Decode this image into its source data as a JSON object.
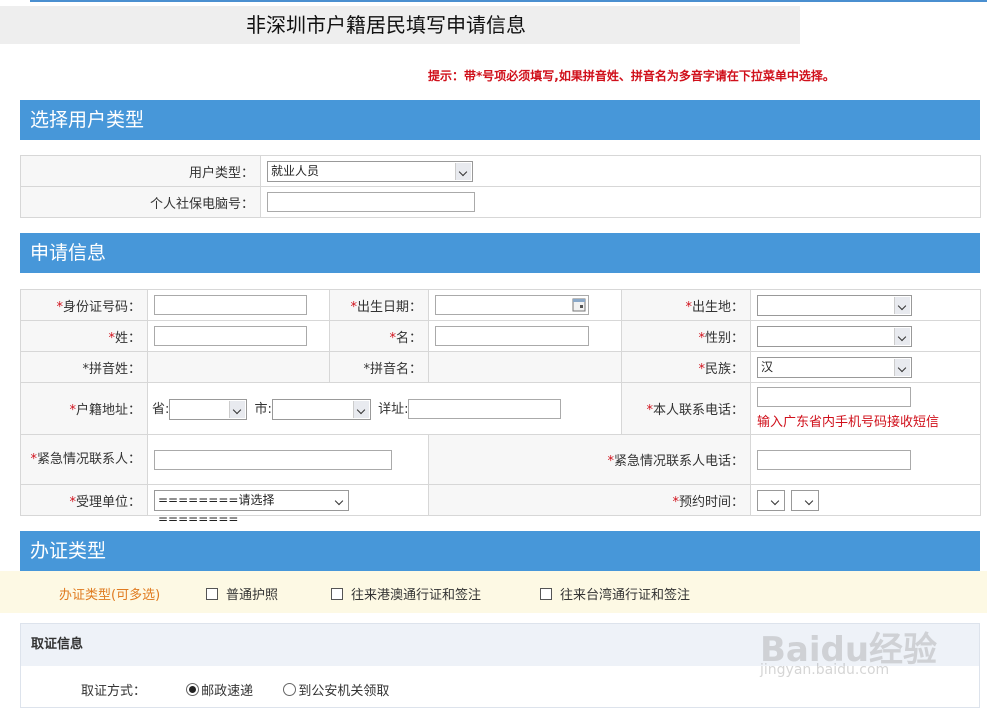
{
  "page_title": "非深圳市户籍居民填写申请信息",
  "tip": "提示：带*号项必须填写,如果拼音姓、拼音名为多音字请在下拉菜单中选择。",
  "section_user_type": {
    "title": "选择用户类型",
    "user_type_label": "用户类型：",
    "user_type_value": "就业人员",
    "social_security_label": "个人社保电脑号："
  },
  "section_apply": {
    "title": "申请信息",
    "req_mark": "*",
    "id_label": "身份证号码：",
    "birth_date_label": "出生日期：",
    "birth_place_label": "出生地：",
    "surname_label": "姓：",
    "given_name_label": "名：",
    "gender_label": "性别：",
    "pinyin_surname_label": "拼音姓：",
    "pinyin_given_label": "拼音名：",
    "ethnicity_label": "民族：",
    "ethnicity_value": "汉",
    "household_label": "户籍地址：",
    "province_label": "省:",
    "city_label": "市:",
    "detail_label": "详址:",
    "phone_label": "本人联系电话：",
    "phone_hint": "输入广东省内手机号码接收短信",
    "emergency_contact_label": "紧急情况联系人：",
    "emergency_phone_label": "紧急情况联系人电话：",
    "office_label": "受理单位：",
    "office_value": "========请选择========",
    "appointment_label": "预约时间："
  },
  "section_cert": {
    "title": "办证类型",
    "types_label": "办证类型(可多选)",
    "options": [
      "普通护照",
      "往来港澳通行证和签注",
      "往来台湾通行证和签注"
    ]
  },
  "section_pickup": {
    "title": "取证信息",
    "method_label": "取证方式：",
    "options": [
      "邮政速递",
      "到公安机关领取"
    ],
    "selected": "邮政速递"
  },
  "watermark": {
    "logo": "Baidu经验",
    "url": "jingyan.baidu.com"
  }
}
